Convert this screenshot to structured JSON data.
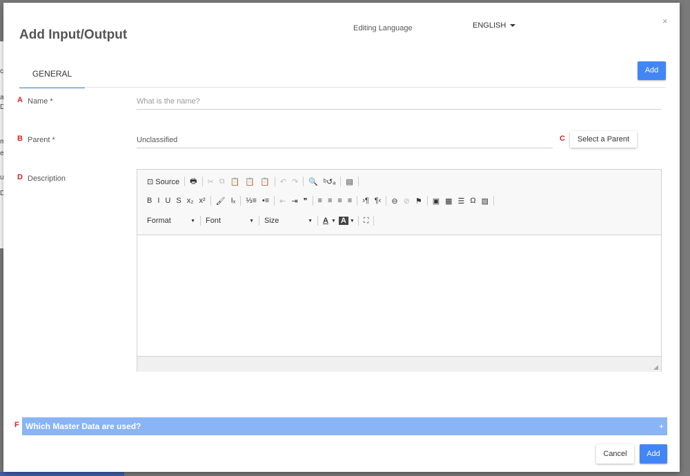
{
  "dialog": {
    "title": "Add Input/Output",
    "editing_language_label": "Editing Language",
    "language_value": "ENGLISH",
    "close_glyph": "×"
  },
  "tabs": [
    {
      "label": "GENERAL",
      "active": true
    }
  ],
  "header_add_label": "Add",
  "background_fragments": [
    "cs",
    "a",
    "Di",
    "m",
    "ee",
    "ur",
    "Du"
  ],
  "form": {
    "name": {
      "marker": "A",
      "label": "Name *",
      "placeholder": "What is the name?",
      "value": ""
    },
    "parent": {
      "marker": "B",
      "label": "Parent *",
      "value": "Unclassified"
    },
    "select_parent": {
      "marker": "C",
      "label": "Select a Parent"
    },
    "description": {
      "marker": "D",
      "label": "Description"
    }
  },
  "editor_toolbar": {
    "row1": [
      {
        "name": "source-button",
        "label": "⊡ Source"
      },
      {
        "name": "print-icon",
        "label": "🖶"
      },
      {
        "name": "cut-icon",
        "label": "✂",
        "disabled": true
      },
      {
        "name": "copy-icon",
        "label": "⧉",
        "disabled": true
      },
      {
        "name": "paste-icon",
        "label": "📋"
      },
      {
        "name": "paste-text-icon",
        "label": "📋"
      },
      {
        "name": "paste-word-icon",
        "label": "📋"
      },
      {
        "name": "undo-icon",
        "label": "↶",
        "disabled": true
      },
      {
        "name": "redo-icon",
        "label": "↷",
        "disabled": true
      },
      {
        "name": "find-icon",
        "label": "🔍"
      },
      {
        "name": "replace-icon",
        "label": "ᵇ↺ₐ"
      },
      {
        "name": "template-icon",
        "label": "▤"
      }
    ],
    "row2": [
      {
        "name": "bold-icon",
        "label": "B"
      },
      {
        "name": "italic-icon",
        "label": "I"
      },
      {
        "name": "underline-icon",
        "label": "U"
      },
      {
        "name": "strike-icon",
        "label": "S"
      },
      {
        "name": "subscript-icon",
        "label": "x₂"
      },
      {
        "name": "superscript-icon",
        "label": "x²"
      },
      {
        "name": "copy-format-icon",
        "label": "🖌"
      },
      {
        "name": "remove-format-icon",
        "label": "Iₓ"
      },
      {
        "name": "numbered-list-icon",
        "label": "⅓≡"
      },
      {
        "name": "bulleted-list-icon",
        "label": "•≡"
      },
      {
        "name": "outdent-icon",
        "label": "⇤",
        "disabled": true
      },
      {
        "name": "indent-icon",
        "label": "⇥"
      },
      {
        "name": "blockquote-icon",
        "label": "❞"
      },
      {
        "name": "align-left-icon",
        "label": "≡"
      },
      {
        "name": "align-center-icon",
        "label": "≡"
      },
      {
        "name": "align-right-icon",
        "label": "≡"
      },
      {
        "name": "justify-icon",
        "label": "≡"
      },
      {
        "name": "ltr-icon",
        "label": "›¶"
      },
      {
        "name": "rtl-icon",
        "label": "¶‹"
      },
      {
        "name": "link-icon",
        "label": "⊖"
      },
      {
        "name": "unlink-icon",
        "label": "⊘",
        "disabled": true
      },
      {
        "name": "anchor-icon",
        "label": "⚑"
      },
      {
        "name": "image-icon",
        "label": "▣"
      },
      {
        "name": "table-icon",
        "label": "▦"
      },
      {
        "name": "horizontal-line-icon",
        "label": "☰"
      },
      {
        "name": "special-char-icon",
        "label": "Ω"
      },
      {
        "name": "iframe-icon",
        "label": "▨"
      }
    ],
    "row3": {
      "format": "Format",
      "font": "Font",
      "size": "Size",
      "text_color": "A",
      "bg_color": "A",
      "maximize": "⛶"
    }
  },
  "accordion": {
    "marker": "F",
    "title": "Which Master Data are used?",
    "icon": "+"
  },
  "footer": {
    "cancel_label": "Cancel",
    "add_label": "Add"
  },
  "colors": {
    "primary": "#4285f4",
    "accordion": "#89b4f5",
    "marker": "#e02020",
    "tab_underline": "#4b87d6"
  }
}
